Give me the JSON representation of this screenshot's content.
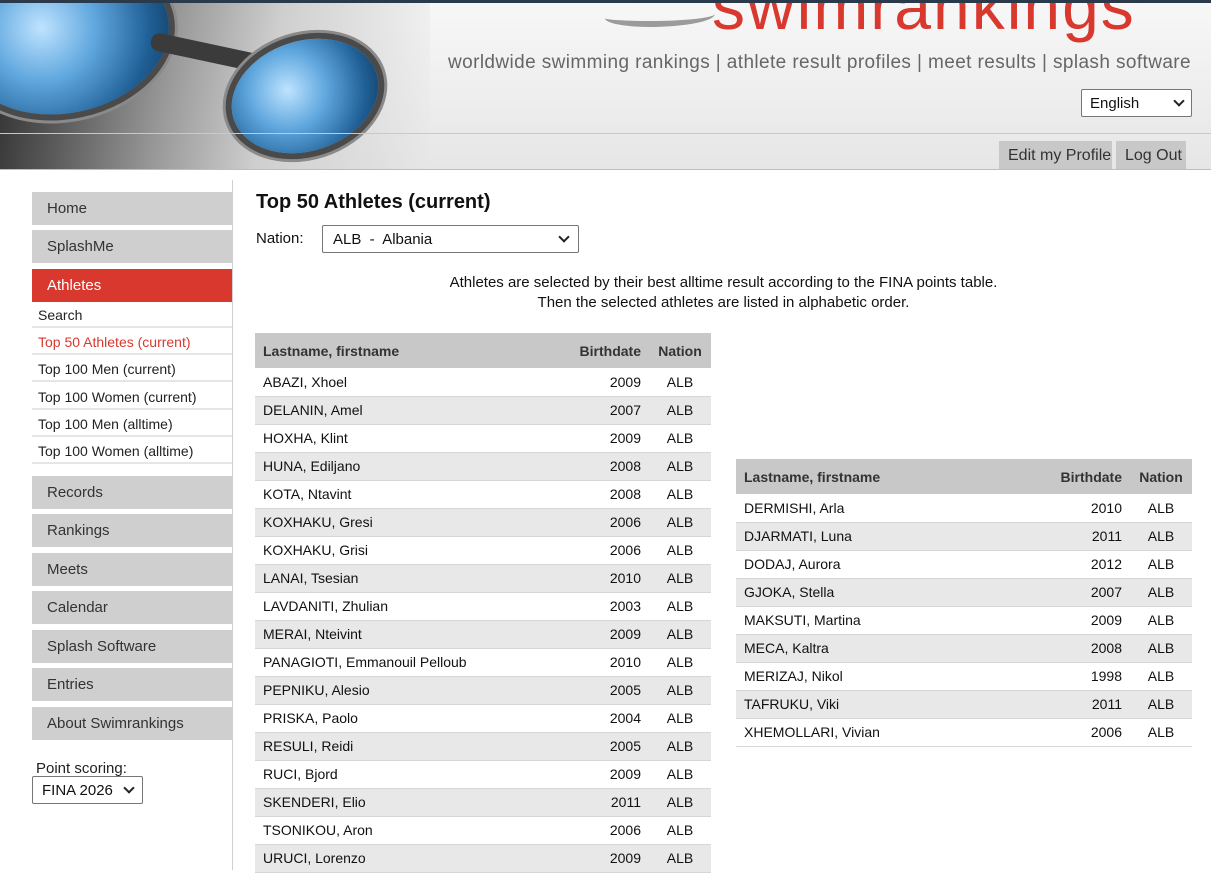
{
  "header": {
    "logo_text": "swimrankings",
    "tagline": "worldwide swimming rankings | athlete result profiles | meet results | splash software",
    "language": "English",
    "edit_profile": "Edit my Profile",
    "log_out": "Log Out"
  },
  "sidebar": {
    "nav": [
      {
        "label": "Home"
      },
      {
        "label": "SplashMe"
      },
      {
        "label": "Athletes"
      },
      {
        "label": "Records"
      },
      {
        "label": "Rankings"
      },
      {
        "label": "Meets"
      },
      {
        "label": "Calendar"
      },
      {
        "label": "Splash Software"
      },
      {
        "label": "Entries"
      },
      {
        "label": "About Swimrankings"
      }
    ],
    "athletes_sub": [
      {
        "label": "Search"
      },
      {
        "label": "Top 50 Athletes (current)"
      },
      {
        "label": "Top 100 Men (current)"
      },
      {
        "label": "Top 100 Women (current)"
      },
      {
        "label": "Top 100 Men (alltime)"
      },
      {
        "label": "Top 100 Women (alltime)"
      }
    ],
    "point_scoring_label": "Point scoring:",
    "point_scoring_value": "FINA 2026"
  },
  "main": {
    "title": "Top 50 Athletes (current)",
    "nation_label": "Nation:",
    "nation_value": "ALB  -  Albania",
    "info_line1": "Athletes are selected by their best alltime result according to the FINA points table.",
    "info_line2": "Then the selected athletes are listed in alphabetic order.",
    "columns": [
      "Lastname, firstname",
      "Birthdate",
      "Nation"
    ],
    "table1": [
      [
        "ABAZI, Xhoel",
        "2009",
        "ALB"
      ],
      [
        "DELANIN, Amel",
        "2007",
        "ALB"
      ],
      [
        "HOXHA, Klint",
        "2009",
        "ALB"
      ],
      [
        "HUNA, Ediljano",
        "2008",
        "ALB"
      ],
      [
        "KOTA, Ntavint",
        "2008",
        "ALB"
      ],
      [
        "KOXHAKU, Gresi",
        "2006",
        "ALB"
      ],
      [
        "KOXHAKU, Grisi",
        "2006",
        "ALB"
      ],
      [
        "LANAI, Tsesian",
        "2010",
        "ALB"
      ],
      [
        "LAVDANITI, Zhulian",
        "2003",
        "ALB"
      ],
      [
        "MERAI, Nteivint",
        "2009",
        "ALB"
      ],
      [
        "PANAGIOTI, Emmanouil Pelloub",
        "2010",
        "ALB"
      ],
      [
        "PEPNIKU, Alesio",
        "2005",
        "ALB"
      ],
      [
        "PRISKA, Paolo",
        "2004",
        "ALB"
      ],
      [
        "RESULI, Reidi",
        "2005",
        "ALB"
      ],
      [
        "RUCI, Bjord",
        "2009",
        "ALB"
      ],
      [
        "SKENDERI, Elio",
        "2011",
        "ALB"
      ],
      [
        "TSONIKOU, Aron",
        "2006",
        "ALB"
      ],
      [
        "URUCI, Lorenzo",
        "2009",
        "ALB"
      ]
    ],
    "table2": [
      [
        "DERMISHI, Arla",
        "2010",
        "ALB"
      ],
      [
        "DJARMATI, Luna",
        "2011",
        "ALB"
      ],
      [
        "DODAJ, Aurora",
        "2012",
        "ALB"
      ],
      [
        "GJOKA, Stella",
        "2007",
        "ALB"
      ],
      [
        "MAKSUTI, Martina",
        "2009",
        "ALB"
      ],
      [
        "MECA, Kaltra",
        "2008",
        "ALB"
      ],
      [
        "MERIZAJ, Nikol",
        "1998",
        "ALB"
      ],
      [
        "TAFRUKU, Viki",
        "2011",
        "ALB"
      ],
      [
        "XHEMOLLARI, Vivian",
        "2006",
        "ALB"
      ]
    ]
  },
  "colors": {
    "accent": "#d8382e",
    "nav_bg": "#cfcfcf",
    "table_header_bg": "#c8c8c8",
    "row_alt_bg": "#e8e8e8"
  }
}
